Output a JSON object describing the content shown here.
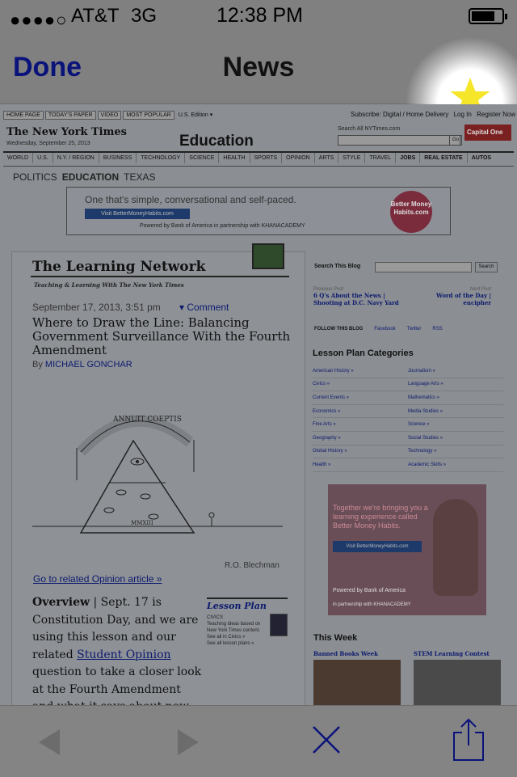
{
  "status_bar": {
    "signal": "●●●●○",
    "carrier": "AT&T",
    "network": "3G",
    "time": "12:38 PM"
  },
  "nav": {
    "done_label": "Done",
    "title": "News"
  },
  "web": {
    "top_links": [
      "HOME PAGE",
      "TODAY'S PAPER",
      "VIDEO",
      "MOST POPULAR",
      "U.S. Edition ▾"
    ],
    "account_links": [
      "Subscribe: Digital / Home Delivery",
      "Log In",
      "Register Now"
    ],
    "logo": "The New York Times",
    "date": "Wednesday, September 25, 2013",
    "section": "Education",
    "search_label": "Search All NYTimes.com",
    "go_label": "Go",
    "sponsor": "Capital One",
    "nav_items": [
      "WORLD",
      "U.S.",
      "N.Y. / REGION",
      "BUSINESS",
      "TECHNOLOGY",
      "SCIENCE",
      "HEALTH",
      "SPORTS",
      "OPINION",
      "ARTS",
      "STYLE",
      "TRAVEL",
      "JOBS",
      "REAL ESTATE",
      "AUTOS"
    ],
    "sub_nav": [
      "POLITICS",
      "EDUCATION",
      "TEXAS"
    ],
    "ad_top": {
      "text": "One that's simple, conversational and self-paced.",
      "button": "Visit BetterMoneyHabits.com",
      "powered": "Powered by  Bank of America  in partnership with  KHANACADEMY",
      "circle": "Better Money Habits.com"
    },
    "blog": {
      "name": "The Learning Network",
      "tagline": "Teaching & Learning With The New York Times"
    },
    "article": {
      "date": "September 17, 2013, 3:51 pm",
      "comment": "Comment",
      "title": "Where to Draw the Line: Balancing Government Surveillance With the Fourth Amendment",
      "by_prefix": "By",
      "author": "MICHAEL GONCHAR",
      "cartoon_year": "MMXIII",
      "cartoon_motto": "ANNUIT COEPTIS",
      "credit": "R.O. Blechman",
      "related": "Go to related Opinion article »",
      "overview_label": "Overview",
      "overview_text_1": " | Sept. 17 is Constitution Day, and we are using this lesson and our related ",
      "overview_link": "Student Opinion",
      "overview_text_2": " question to take a closer look at the Fourth Amendment and what it says about new government surveillance techniques."
    },
    "lesson_plan": {
      "heading": "Lesson Plan",
      "category": "CIVICS",
      "desc": "Teaching ideas based on New York Times content.",
      "links": [
        "See all in Civics »",
        "See all lesson plans »"
      ]
    },
    "sidebar": {
      "search_label": "Search This Blog",
      "search_button": "Search",
      "prev_label": "Previous Post",
      "prev_title": "6 Q's About the News | Shooting at D.C. Navy Yard",
      "next_label": "Next Post",
      "next_title": "Word of the Day | encipher",
      "follow": "FOLLOW THIS BLOG",
      "follow_links": [
        "Facebook",
        "Twitter",
        "RSS"
      ],
      "categories_heading": "Lesson Plan Categories",
      "categories": [
        [
          "American History »",
          "Journalism »"
        ],
        [
          "Civics »",
          "Language Arts »"
        ],
        [
          "Current Events »",
          "Mathematics »"
        ],
        [
          "Economics »",
          "Media Studies »"
        ],
        [
          "Fine Arts »",
          "Science »"
        ],
        [
          "Geography »",
          "Social Studies »"
        ],
        [
          "Global History »",
          "Technology »"
        ],
        [
          "Health »",
          "Academic Skills »"
        ]
      ],
      "ad": {
        "text": "Together we're bringing you a learning experience called Better Money Habits.",
        "button": "Visit BetterMoneyHabits.com",
        "powered": "Powered by Bank of America",
        "partner": "in partnership with KHANACADEMY"
      },
      "this_week": "This Week",
      "week_items": [
        "Banned Books Week",
        "STEM Learning Contest"
      ]
    }
  },
  "colors": {
    "overlay_gray": "#808080",
    "link_blue": "#0b1a6e",
    "star_yellow": "#f5e62a"
  },
  "toolbar": {
    "icons": [
      "back-arrow-icon",
      "forward-arrow-icon",
      "close-icon",
      "share-icon"
    ]
  }
}
